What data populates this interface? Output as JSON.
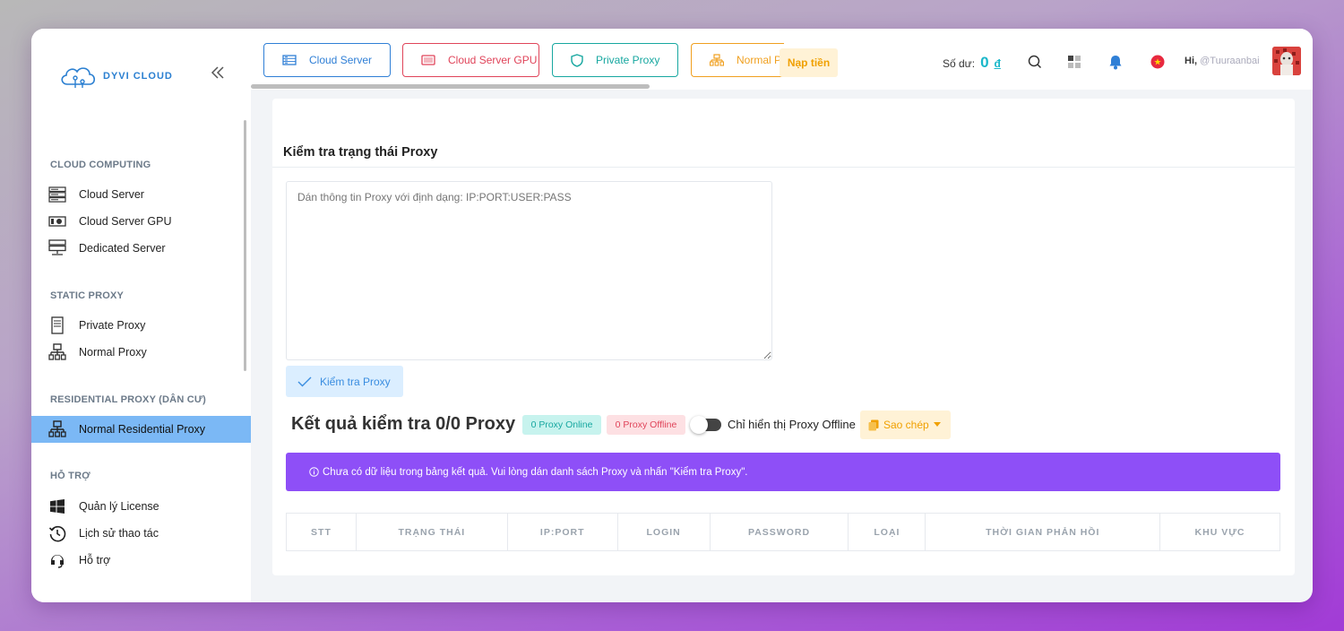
{
  "brand": {
    "name": "DYVI CLOUD"
  },
  "sidebar": {
    "sections": [
      {
        "title": "CLOUD COMPUTING",
        "items": [
          {
            "label": "Cloud Server",
            "icon": "server-rack-icon"
          },
          {
            "label": "Cloud Server GPU",
            "icon": "gpu-icon"
          },
          {
            "label": "Dedicated Server",
            "icon": "dedicated-server-icon"
          }
        ]
      },
      {
        "title": "STATIC PROXY",
        "items": [
          {
            "label": "Private Proxy",
            "icon": "tower-server-icon"
          },
          {
            "label": "Normal Proxy",
            "icon": "network-icon"
          }
        ]
      },
      {
        "title": "RESIDENTIAL PROXY (DÂN CƯ)",
        "items": [
          {
            "label": "Normal Residential Proxy",
            "icon": "network-icon",
            "active": true
          }
        ]
      },
      {
        "title": "HỖ TRỢ",
        "items": [
          {
            "label": "Quản lý License",
            "icon": "windows-icon"
          },
          {
            "label": "Lịch sử thao tác",
            "icon": "history-icon"
          },
          {
            "label": "Hỗ trợ",
            "icon": "headset-icon"
          }
        ]
      }
    ]
  },
  "topbar": {
    "tabs": [
      {
        "label": "Cloud Server",
        "icon": "server-icon",
        "color": "#2f7fd6"
      },
      {
        "label": "Cloud Server GPU",
        "icon": "gpu-icon",
        "color": "#e0445a"
      },
      {
        "label": "Private Proxy",
        "icon": "shield-icon",
        "color": "#17a7a0"
      },
      {
        "label": "Normal Pr",
        "icon": "network-icon",
        "color": "#f0a020"
      }
    ],
    "topup_label": "Nạp tiền",
    "balance_label": "Số dư:",
    "balance_amount": "0",
    "balance_currency": "đ",
    "greeting": "Hi,",
    "username": "@Tuuraanbai"
  },
  "main": {
    "title": "Kiểm tra trạng thái Proxy",
    "textarea_placeholder": "Dán thông tin Proxy với định dạng: IP:PORT:USER:PASS",
    "check_button": "Kiểm tra Proxy",
    "result_title": "Kết quả kiểm tra 0/0 Proxy",
    "online_badge": "0 Proxy Online",
    "offline_badge": "0 Proxy Offline",
    "toggle_label": "Chỉ hiển thị Proxy Offline",
    "copy_button": "Sao chép",
    "alert_text": "Chưa có dữ liệu trong bảng kết quả. Vui lòng dán danh sách Proxy và nhấn \"Kiểm tra Proxy\".",
    "table_headers": [
      "STT",
      "TRẠNG THÁI",
      "IP:PORT",
      "LOGIN",
      "PASSWORD",
      "LOẠI",
      "THỜI GIAN PHẢN HỒI",
      "KHU VỰC"
    ]
  },
  "colors": {
    "accent_blue": "#2f7fd6",
    "sidebar_active": "#7bb8f5",
    "alert_purple": "#8e4ff7",
    "teal": "#17a7a0",
    "red": "#e0445a",
    "orange": "#f0a000"
  }
}
